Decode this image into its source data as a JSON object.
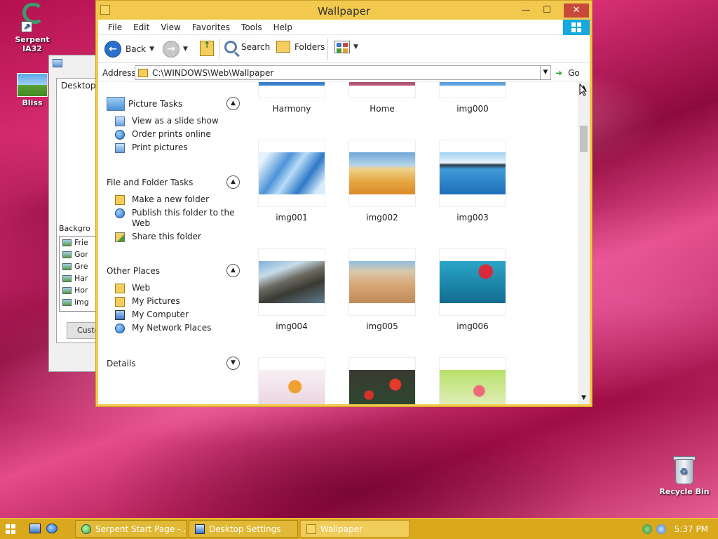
{
  "desktop": {
    "icons": [
      {
        "label": "Serpent IA32"
      },
      {
        "label": "Bliss"
      },
      {
        "label": "Recycle Bin"
      }
    ]
  },
  "bg_dialog": {
    "tab_label": "Desktop",
    "background_label": "Backgro",
    "list": [
      "Frie",
      "Gor",
      "Gre",
      "Har",
      "Hor",
      "img",
      "img"
    ],
    "custom_button": "Custo"
  },
  "window": {
    "title": "Wallpaper",
    "controls": {
      "minimize": "—",
      "maximize": "☐",
      "close": "✕"
    },
    "menu": [
      "File",
      "Edit",
      "View",
      "Favorites",
      "Tools",
      "Help"
    ],
    "toolbar": {
      "back": "Back",
      "search": "Search",
      "folders": "Folders"
    },
    "address": {
      "label": "Address",
      "value": "C:\\WINDOWS\\Web\\Wallpaper",
      "go": "Go"
    },
    "tasks": {
      "picture": {
        "title": "Picture Tasks",
        "items": [
          "View as a slide show",
          "Order prints online",
          "Print pictures"
        ]
      },
      "file_folder": {
        "title": "File and Folder Tasks",
        "items": [
          "Make a new folder",
          "Publish this folder to the Web",
          "Share this folder"
        ]
      },
      "other_places": {
        "title": "Other Places",
        "items": [
          "Web",
          "My Pictures",
          "My Computer",
          "My Network Places"
        ]
      },
      "details": {
        "title": "Details"
      }
    },
    "thumbnails": [
      {
        "name": "Harmony"
      },
      {
        "name": "Home"
      },
      {
        "name": "img000"
      },
      {
        "name": "img001"
      },
      {
        "name": "img002"
      },
      {
        "name": "img003"
      },
      {
        "name": "img004"
      },
      {
        "name": "img005"
      },
      {
        "name": "img006"
      },
      {
        "name": ""
      },
      {
        "name": ""
      },
      {
        "name": ""
      }
    ]
  },
  "taskbar": {
    "buttons": [
      {
        "label": "Serpent Start Page - ..."
      },
      {
        "label": "Desktop Settings"
      },
      {
        "label": "Wallpaper"
      }
    ],
    "clock": "5:37 PM"
  },
  "colors": {
    "window_frame": "#f2c94c",
    "taskbar": "#d9a81c",
    "close_button": "#c7493a",
    "windows_flag": "#18a8e0"
  }
}
